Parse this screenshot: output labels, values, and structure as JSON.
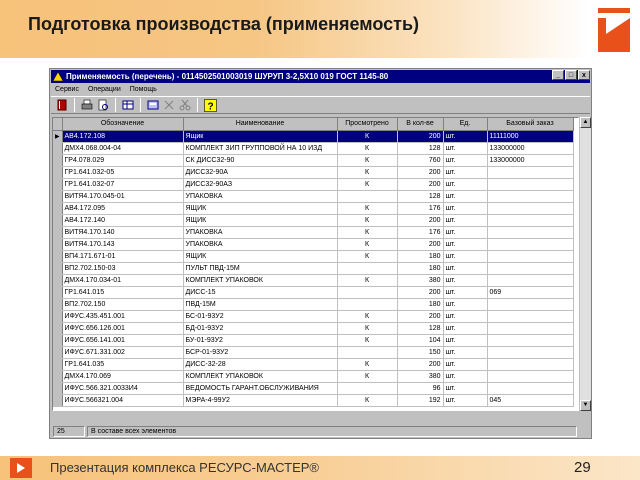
{
  "slide": {
    "title": "Подготовка производства (применяемость)",
    "footer_text": "Презентация комплекса РЕСУРС-МАСТЕР®",
    "page_number": "29",
    "accent_color": "#f7c27a"
  },
  "window": {
    "title": "Применяемость (перечень) - 0114502501003019 ШУРУП 3-2,5Х10 019 ГОСТ 1145-80",
    "controls": [
      "_",
      "□",
      "x"
    ],
    "menu": [
      "Сервис",
      "Операции",
      "Помощь"
    ],
    "toolbar_icons": [
      "book-icon",
      "print-icon",
      "preview-icon",
      "table-icon",
      "form-icon",
      "cut-icon",
      "scissors-icon",
      "help-icon"
    ]
  },
  "grid": {
    "columns": [
      "Обозначение",
      "Наименование",
      "Просмотрено",
      "В кол-ве",
      "Ед.",
      "Базовый заказ"
    ],
    "rows": [
      [
        "АВ4.172.108",
        "Ящик",
        "К",
        "200",
        "шт.",
        "11111000"
      ],
      [
        "ДМХ4.068.004-04",
        "КОМПЛЕКТ ЗИП ГРУППОВОЙ НА 10 ИЗД",
        "К",
        "128",
        "шт.",
        "133000000"
      ],
      [
        "ГР4.078.029",
        "СК ДИСС32-90",
        "К",
        "760",
        "шт.",
        "133000000"
      ],
      [
        "ГР1.641.032-05",
        "ДИСС32-90А",
        "К",
        "200",
        "шт.",
        ""
      ],
      [
        "ГР1.641.032-07",
        "ДИСС32-90АЗ",
        "К",
        "200",
        "шт.",
        ""
      ],
      [
        "ВИТЯ4.170.045-01",
        "УПАКОВКА",
        "",
        "128",
        "шт.",
        ""
      ],
      [
        "АВ4.172.095",
        "ЯЩИК",
        "К",
        "176",
        "шт.",
        ""
      ],
      [
        "АВ4.172.140",
        "ЯЩИК",
        "К",
        "200",
        "шт.",
        ""
      ],
      [
        "ВИТЯ4.170.140",
        "УПАКОВКА",
        "К",
        "176",
        "шт.",
        ""
      ],
      [
        "ВИТЯ4.170.143",
        "УПАКОВКА",
        "К",
        "200",
        "шт.",
        ""
      ],
      [
        "ВП4.171.671-01",
        "ЯЩИК",
        "К",
        "180",
        "шт.",
        ""
      ],
      [
        "ВП2.702.150-03",
        "ПУЛЬТ  ПВД-15М",
        "",
        "180",
        "шт.",
        ""
      ],
      [
        "ДМХ4.170.034-01",
        "КОМПЛЕКТ УПАКОВОК",
        "К",
        "380",
        "шт.",
        ""
      ],
      [
        "ГР1.641.015",
        "ДИСС-15",
        "",
        "200",
        "шт.",
        "069"
      ],
      [
        "ВП2.702.150",
        "ПВД-15М",
        "",
        "180",
        "шт.",
        ""
      ],
      [
        "ИФУС.435.451.001",
        "БС-01-93У2",
        "К",
        "200",
        "шт.",
        ""
      ],
      [
        "ИФУС.656.126.001",
        "БД-01-93У2",
        "К",
        "128",
        "шт.",
        ""
      ],
      [
        "ИФУС.656.141.001",
        "БУ-01-93У2",
        "К",
        "104",
        "шт.",
        ""
      ],
      [
        "ИФУС.671.331.002",
        "БСР-01-93У2",
        "",
        "150",
        "шт.",
        ""
      ],
      [
        "ГР1.641.035",
        "ДИСС-32-28",
        "К",
        "200",
        "шт.",
        ""
      ],
      [
        "ДМХ4.170.069",
        "КОМПЛЕКТ УПАКОВОК",
        "К",
        "380",
        "шт.",
        ""
      ],
      [
        "ИФУС.566.321.0033И4",
        "ВЕДОМОСТЬ ГАРАНТ.ОБСЛУЖИВАНИЯ",
        "",
        "96",
        "шт.",
        ""
      ],
      [
        "ИФУС.566321.004",
        "МЭРА-4-99У2",
        "К",
        "192",
        "шт.",
        "045"
      ]
    ]
  },
  "status": {
    "count": "25",
    "mode": "В составе всех элементов"
  }
}
